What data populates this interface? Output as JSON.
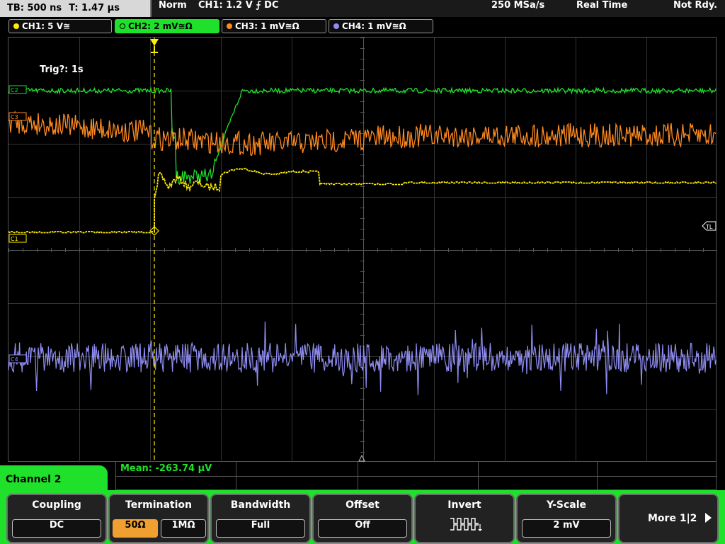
{
  "topbar": {
    "timebase": "TB: 500 ns",
    "trigger_time": "T: 1.47 µs",
    "trigger_mode": "Norm",
    "ch1_setting": "CH1: 1.2 V ⨍ DC",
    "sample_rate": "250 MSa/s",
    "acq_mode": "Real Time",
    "status": "Not Rdy."
  },
  "tabs": [
    {
      "label": "CH1: 5 V≅",
      "color": "#ffee00"
    },
    {
      "label": "CH2: 2 mV≅Ω",
      "color": "#1fe02a"
    },
    {
      "label": "CH3: 1 mV≅Ω",
      "color": "#ff8a20"
    },
    {
      "label": "CH4: 1 mV≅Ω",
      "color": "#8e8cf0"
    }
  ],
  "plot": {
    "trig_status": "Trig?: 1s",
    "markers": {
      "ch2": "C2",
      "ch3": "C3",
      "ch1": "C1",
      "ch4": "C4",
      "trig_level": "TL"
    }
  },
  "measurement": {
    "mean": "Mean: -263.74 µV"
  },
  "menu": {
    "channel_title": "Channel 2",
    "coupling": {
      "label": "Coupling",
      "value": "DC"
    },
    "termination": {
      "label": "Termination",
      "options": [
        "50Ω",
        "1MΩ"
      ],
      "selected": "50Ω"
    },
    "bandwidth": {
      "label": "Bandwidth",
      "value": "Full"
    },
    "offset": {
      "label": "Offset",
      "value": "Off"
    },
    "invert": {
      "label": "Invert",
      "icon": "square-wave-icon"
    },
    "yscale": {
      "label": "Y-Scale",
      "value": "2 mV"
    },
    "more": {
      "label": "More 1|2"
    }
  },
  "colors": {
    "ch1": "#ffee00",
    "ch2": "#1fe02a",
    "ch3": "#ff8a20",
    "ch4": "#8e8cf0",
    "accent": "#1fe02a",
    "selected": "#f0a030"
  }
}
